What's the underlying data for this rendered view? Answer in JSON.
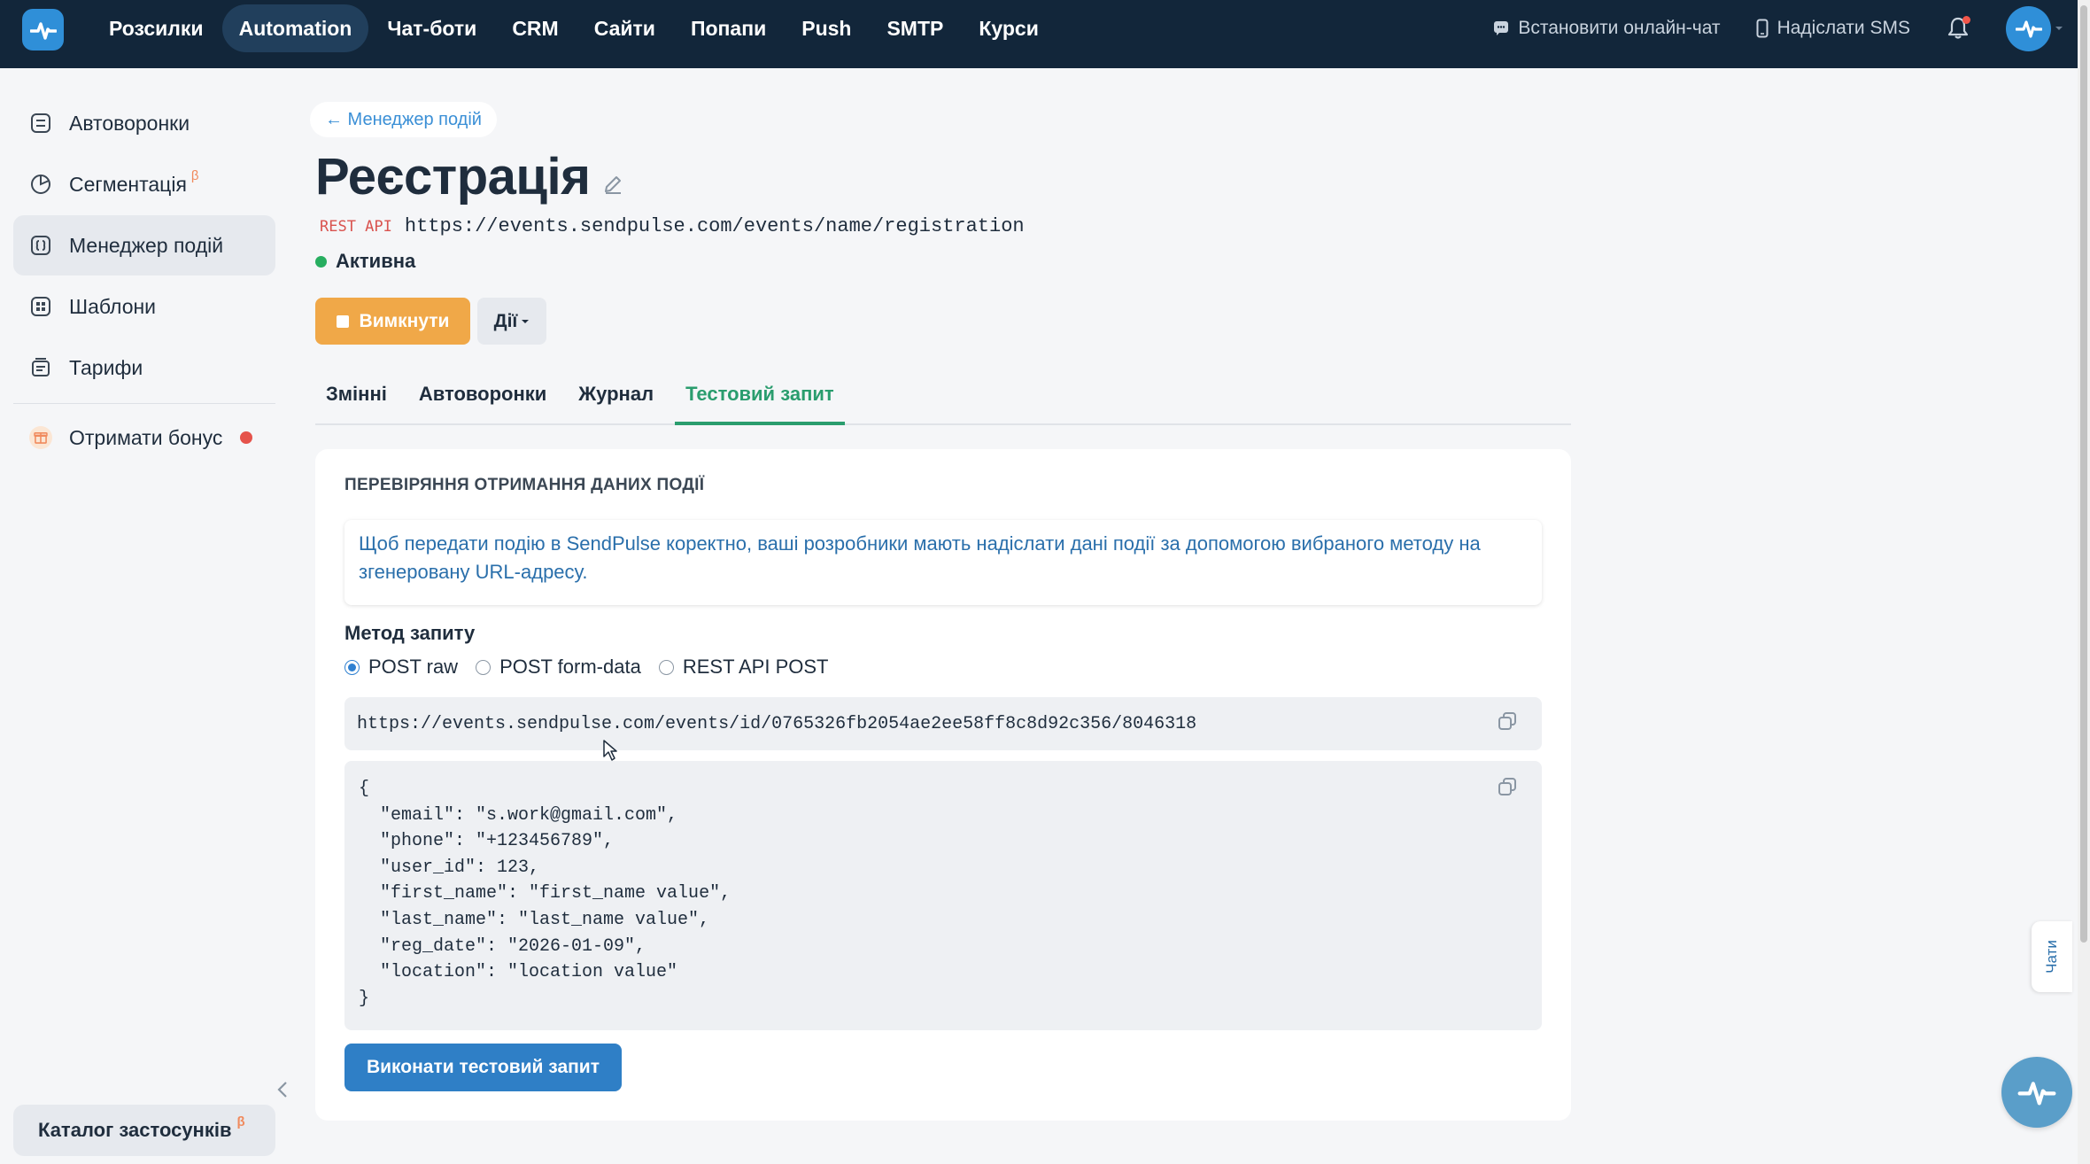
{
  "topnav": {
    "items": [
      {
        "label": "Розсилки",
        "active": false
      },
      {
        "label": "Automation",
        "active": true
      },
      {
        "label": "Чат-боти",
        "active": false
      },
      {
        "label": "CRM",
        "active": false
      },
      {
        "label": "Сайти",
        "active": false
      },
      {
        "label": "Попапи",
        "active": false
      },
      {
        "label": "Push",
        "active": false
      },
      {
        "label": "SMTP",
        "active": false
      },
      {
        "label": "Курси",
        "active": false
      }
    ],
    "install_chat": "Встановити онлайн-чат",
    "send_sms": "Надіслати SMS"
  },
  "sidebar": {
    "items": [
      {
        "label": "Автоворонки",
        "icon": "funnel-icon"
      },
      {
        "label": "Сегментація",
        "icon": "pie-chart-icon",
        "beta": "β"
      },
      {
        "label": "Менеджер подій",
        "icon": "event-manager-icon",
        "active": true
      },
      {
        "label": "Шаблони",
        "icon": "templates-icon"
      },
      {
        "label": "Тарифи",
        "icon": "tariffs-icon"
      },
      {
        "label": "Отримати бонус",
        "icon": "gift-icon"
      }
    ],
    "catalog_label": "Каталог застосунків",
    "catalog_beta": "β"
  },
  "breadcrumb": "← Менеджер подій",
  "page": {
    "title": "Реєстрація",
    "api_tag": "REST API",
    "api_url": "https://events.sendpulse.com/events/name/registration",
    "status": "Активна",
    "status_color": "#27ae60"
  },
  "buttons": {
    "disable": "Вимкнути",
    "actions": "Дії"
  },
  "tabs": [
    {
      "label": "Змінні",
      "active": false
    },
    {
      "label": "Автоворонки",
      "active": false
    },
    {
      "label": "Журнал",
      "active": false
    },
    {
      "label": "Тестовий запит",
      "active": true
    }
  ],
  "test_request": {
    "heading": "ПЕРЕВІРЯННЯ ОТРИМАННЯ ДАНИХ ПОДІЇ",
    "info": "Щоб передати подію в SendPulse коректно, ваші розробники мають надіслати дані події за допомогою вибраного методу на згенеровану URL-адресу.",
    "method_label": "Метод запиту",
    "methods": [
      {
        "label": "POST raw",
        "checked": true
      },
      {
        "label": "POST form-data",
        "checked": false
      },
      {
        "label": "REST API POST",
        "checked": false
      }
    ],
    "endpoint_url": "https://events.sendpulse.com/events/id/0765326fb2054ae2ee58ff8c8d92c356/8046318",
    "payload": "{\n  \"email\": \"s.work@gmail.com\",\n  \"phone\": \"+123456789\",\n  \"user_id\": 123,\n  \"first_name\": \"first_name value\",\n  \"last_name\": \"last_name value\",\n  \"reg_date\": \"2026-01-09\",\n  \"location\": \"location value\"\n}",
    "run_button": "Виконати тестовий запит"
  },
  "widgets": {
    "chats_tab": "Чати"
  },
  "colors": {
    "topbar": "#12263a",
    "accent_blue": "#2f7fc6",
    "accent_green": "#2a9d6e",
    "disable_orange": "#f0a848"
  }
}
